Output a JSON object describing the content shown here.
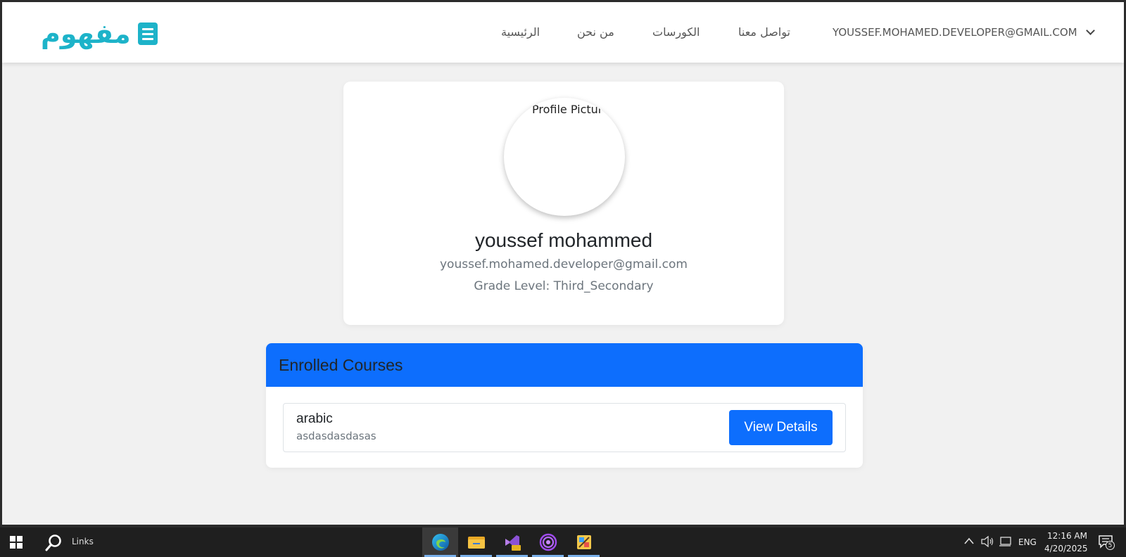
{
  "navbar": {
    "brand": "مفهوم",
    "links": {
      "home": "الرئيسية",
      "about": "من نحن",
      "courses": "الكورسات",
      "contact": "تواصل معنا"
    },
    "user_email": "YOUSSEF.MOHAMED.DEVELOPER@GMAIL.COM"
  },
  "profile": {
    "avatar_alt": "Profile Pictur",
    "name": "youssef mohammed",
    "email": "youssef.mohamed.developer@gmail.com",
    "grade": "Grade Level: Third_Secondary"
  },
  "courses": {
    "title": "Enrolled Courses",
    "items": [
      {
        "name": "arabic",
        "description": "asdasdasdasas",
        "button": "View Details"
      }
    ]
  },
  "taskbar": {
    "search_label": "Links",
    "apps": [
      "edge-icon",
      "file-explorer-icon",
      "visual-studio-preview-icon",
      "spiral-app-icon",
      "paint-app-icon"
    ],
    "language": "ENG",
    "time": "12:16 AM",
    "date": "4/20/2025",
    "notifications": "5"
  },
  "colors": {
    "brand": "#1db3c9",
    "primary": "#0d6efd",
    "page_bg": "#f1f1f1"
  }
}
